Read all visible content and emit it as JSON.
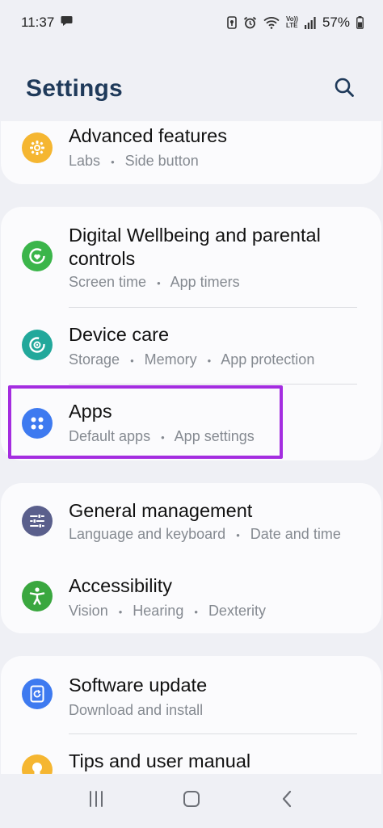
{
  "status_bar": {
    "time": "11:37",
    "battery_percent": "57%",
    "icons": [
      "chat-bubble-icon",
      "vpn-key-icon",
      "alarm-icon",
      "wifi-icon",
      "volte-icon",
      "signal-icon",
      "battery-icon"
    ],
    "volte_top": "Vo))",
    "volte_bottom": "LTE"
  },
  "header": {
    "title": "Settings",
    "search_icon": "search-icon"
  },
  "sections": [
    {
      "items": [
        {
          "title": "Advanced features",
          "subtitle": [
            "Labs",
            "Side button"
          ],
          "icon": "puzzle-gear-icon",
          "color": "#f5b631"
        }
      ]
    },
    {
      "items": [
        {
          "title": "Digital Wellbeing and parental controls",
          "subtitle": [
            "Screen time",
            "App timers"
          ],
          "icon": "wellbeing-icon",
          "color": "#3bb54a"
        },
        {
          "title": "Device care",
          "subtitle": [
            "Storage",
            "Memory",
            "App protection"
          ],
          "icon": "device-care-icon",
          "color": "#22a89b"
        },
        {
          "title": "Apps",
          "subtitle": [
            "Default apps",
            "App settings"
          ],
          "icon": "apps-grid-icon",
          "color": "#3e7af0"
        }
      ]
    },
    {
      "items": [
        {
          "title": "General management",
          "subtitle": [
            "Language and keyboard",
            "Date and time"
          ],
          "icon": "sliders-icon",
          "color": "#5a5f8c"
        },
        {
          "title": "Accessibility",
          "subtitle": [
            "Vision",
            "Hearing",
            "Dexterity"
          ],
          "icon": "accessibility-icon",
          "color": "#3aa73f"
        }
      ]
    },
    {
      "items": [
        {
          "title": "Software update",
          "subtitle": [
            "Download and install"
          ],
          "icon": "software-update-icon",
          "color": "#3e7af0"
        },
        {
          "title": "Tips and user manual",
          "subtitle": [],
          "icon": "lightbulb-icon",
          "color": "#f5b631"
        }
      ]
    }
  ],
  "highlighted_item": "Apps",
  "highlight_color": "#a42de0",
  "subtitle_separator": "•",
  "nav_bar": {
    "buttons": [
      "recents-icon",
      "home-icon",
      "back-icon"
    ]
  }
}
